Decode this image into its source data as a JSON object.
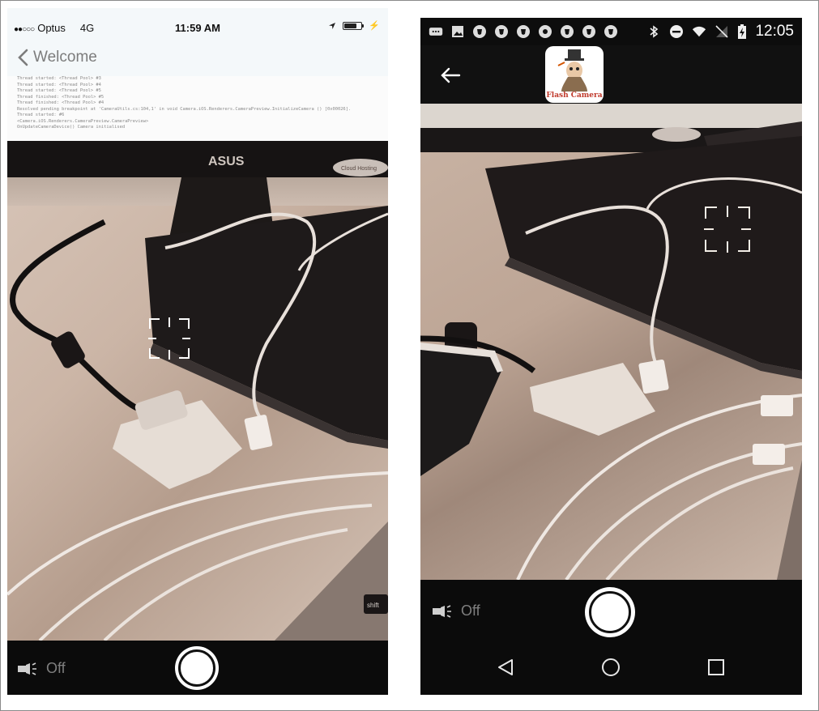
{
  "ios": {
    "status": {
      "carrier": "Optus",
      "network": "4G",
      "time": "11:59 AM"
    },
    "nav": {
      "back_label": "Welcome"
    },
    "log_lines": [
      "Thread started: <Thread Pool> #3",
      "Thread started: <Thread Pool> #4",
      "Thread started: <Thread Pool> #5",
      "Thread finished: <Thread Pool> #5",
      "Thread finished: <Thread Pool> #4",
      "Resolved pending breakpoint at 'CameraUtils.cs:104,1' in void Camera.iOS.Renderers.CameraPreview.InitializeCamera () [0x00026].",
      "Thread started: #6",
      "  <Camera.iOS.Renderers.CameraPreview.CameraPreview>",
      "  OnUpdateCameraDevice() Camera initialised"
    ],
    "camera": {
      "monitor_brand": "ASUS",
      "sticker": "Cloud Hosting",
      "keyboard_key": "shift"
    },
    "flash_label": "Off"
  },
  "android": {
    "status": {
      "time": "12:05"
    },
    "appbar": {
      "logo_text": "Flash Camera"
    },
    "flash_label": "Off"
  }
}
